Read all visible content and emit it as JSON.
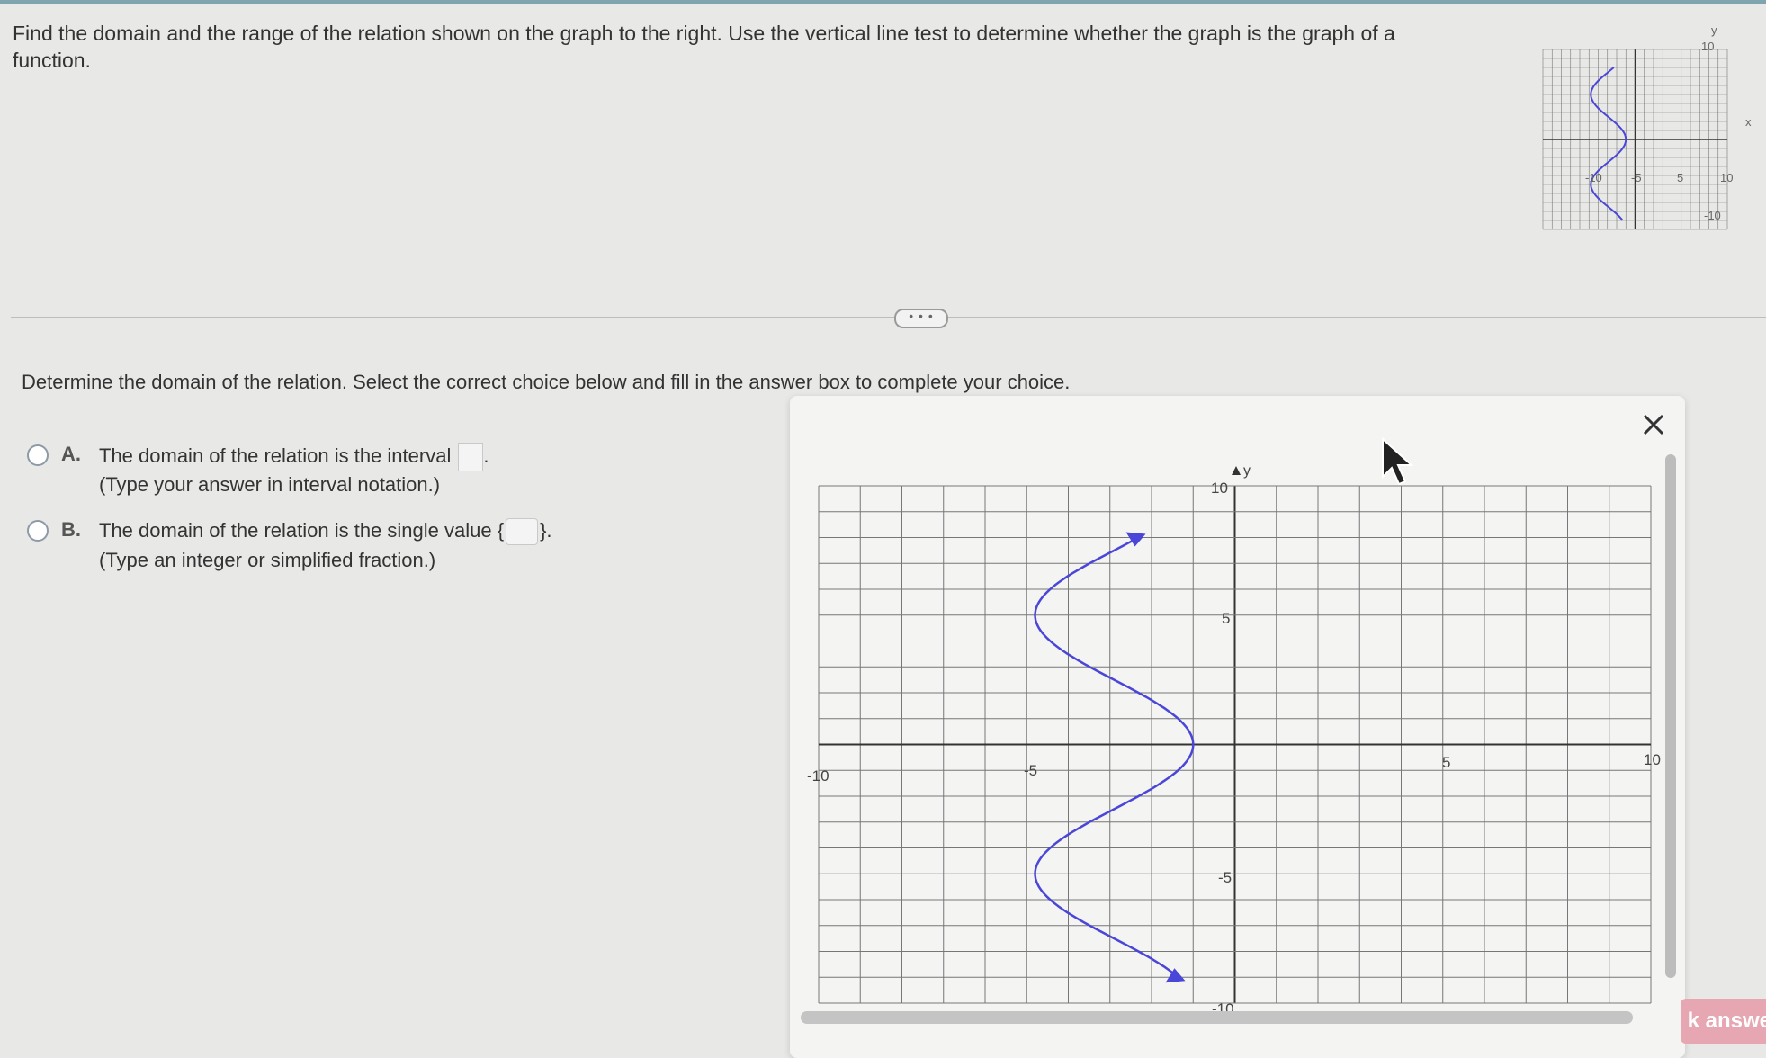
{
  "question": {
    "text": "Find the domain and the range of the relation shown on the graph to the right. Use the vertical line test to determine whether the graph is the graph of a function."
  },
  "prompt": "Determine the domain of the relation. Select the correct choice below and fill in the answer box to complete your choice.",
  "choices": [
    {
      "letter": "A.",
      "text": "The domain of the relation is the interval",
      "hint": "(Type your answer in interval notation.)"
    },
    {
      "letter": "B.",
      "text": "The domain of the relation is the single value",
      "hint": "(Type an integer or simplified fraction.)"
    }
  ],
  "expand_label": "• • •",
  "close_label": "×",
  "check_button": "k answe",
  "graph": {
    "x_label": "x",
    "y_label": "y",
    "x_tick_labels": [
      "-10",
      "-5",
      "5",
      "10"
    ],
    "y_tick_labels": [
      "10",
      "5",
      "-5",
      "-10"
    ],
    "curve_color": "#4a46d8"
  }
}
